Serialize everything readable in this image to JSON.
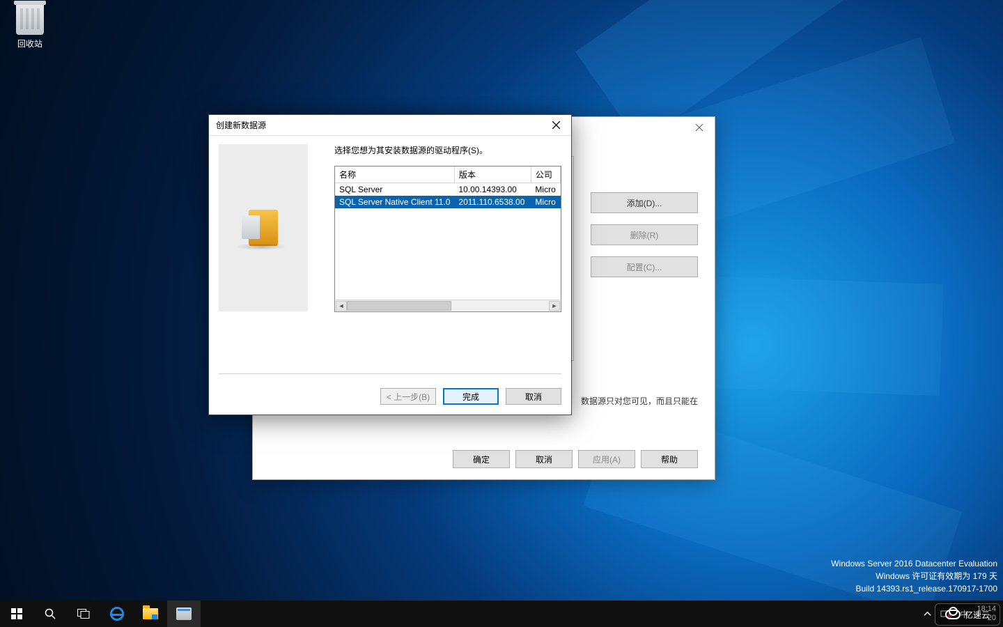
{
  "desktop": {
    "recycle_bin_label": "回收站"
  },
  "watermark": {
    "line1": "Windows Server 2016 Datacenter Evaluation",
    "line2": "Windows 许可证有效期为 179 天",
    "line3": "Build 14393.rs1_release.170917-1700"
  },
  "taskbar": {
    "ime_lang": "中",
    "clock_time": "18:14",
    "clock_date_prefix": "20"
  },
  "background_window": {
    "side_buttons": {
      "add": "添加(D)...",
      "delete": "删除(R)",
      "configure": "配置(C)..."
    },
    "hint": "数据源只对您可见，而且只能在",
    "bottom_buttons": {
      "ok": "确定",
      "cancel": "取消",
      "apply": "应用(A)",
      "help": "帮助"
    }
  },
  "wizard": {
    "title": "创建新数据源",
    "instruction": "选择您想为其安装数据源的驱动程序(S)。",
    "columns": {
      "name": "名称",
      "version": "版本",
      "company": "公司"
    },
    "rows": [
      {
        "name": "SQL Server",
        "version": "10.00.14393.00",
        "company": "Micro"
      },
      {
        "name": "SQL Server Native Client 11.0",
        "version": "2011.110.6538.00",
        "company": "Micro"
      }
    ],
    "buttons": {
      "back": "< 上一步(B)",
      "finish": "完成",
      "cancel": "取消"
    }
  },
  "cloud_badge": {
    "text": "亿速云"
  }
}
